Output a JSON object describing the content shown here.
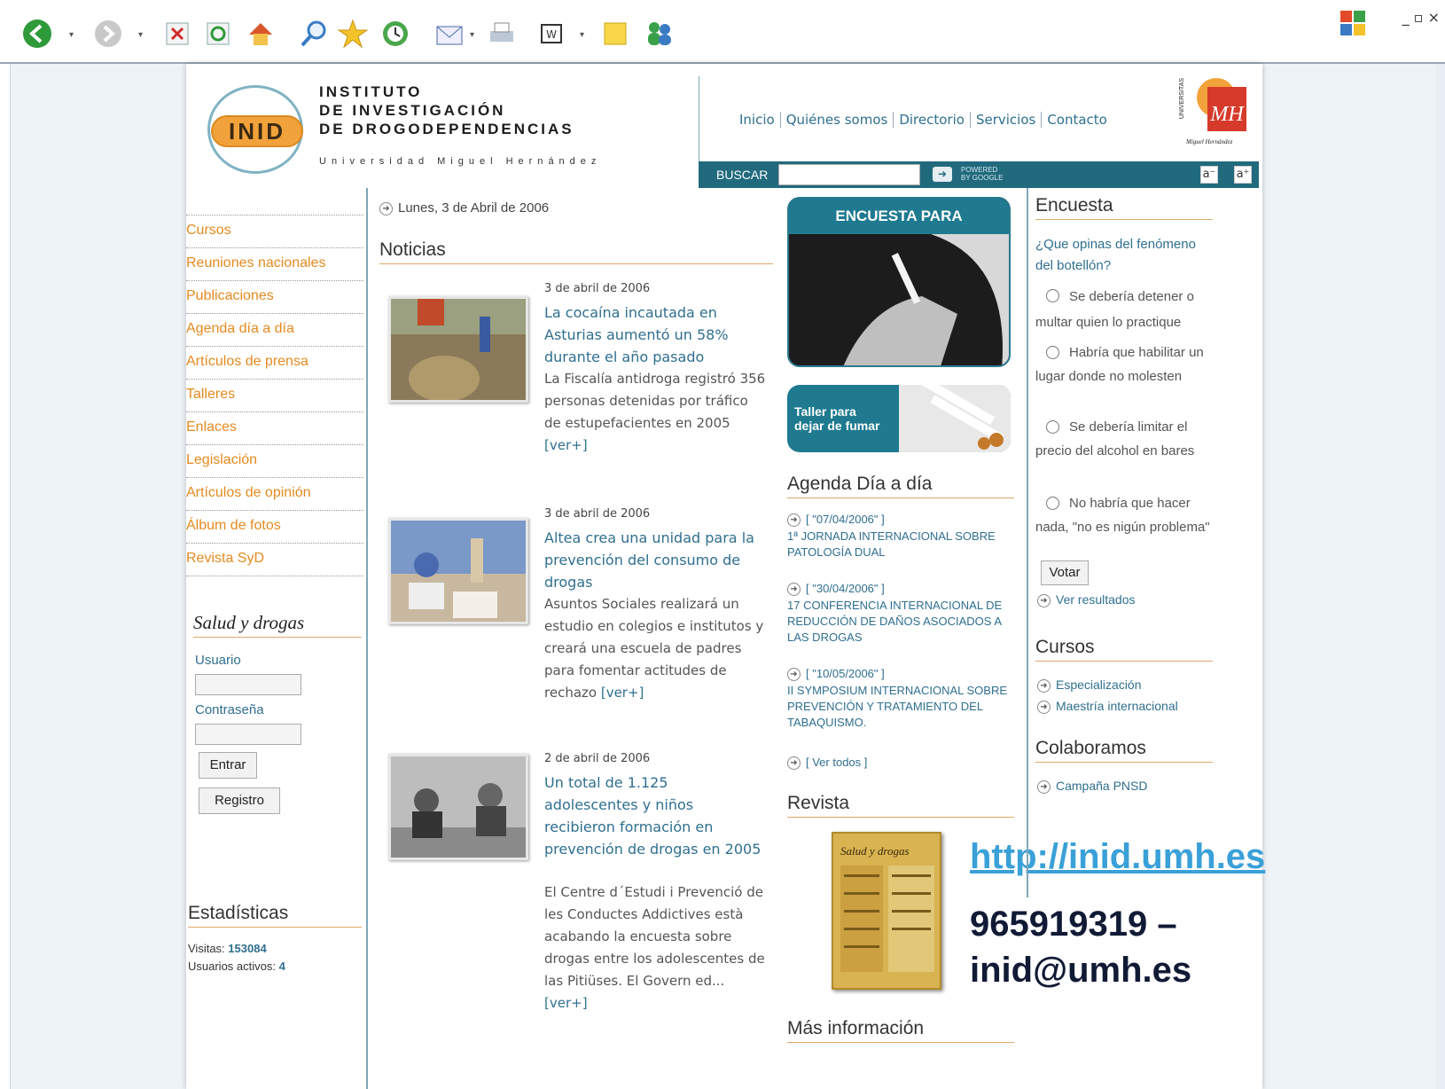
{
  "browser": {
    "toolbar_icons": [
      "back-icon",
      "forward-icon",
      "stop-icon",
      "refresh-icon",
      "home-icon",
      "search-icon",
      "favorites-icon",
      "history-icon",
      "mail-icon",
      "print-icon",
      "edit-icon",
      "notes-icon",
      "messenger-icon"
    ],
    "window_controls": "_ ▫ ×"
  },
  "header": {
    "logo_text": "INID",
    "institute_line1": "INSTITUTO",
    "institute_line2": "DE INVESTIGACIÓN",
    "institute_line3": "DE DROGODEPENDENCIAS",
    "university": "Universidad Miguel Hernández",
    "nav": [
      "Inicio",
      "Quiénes somos",
      "Directorio",
      "Servicios",
      "Contacto"
    ],
    "umh_vertical": "UNIVERSITAS",
    "umh_name": "Miguel Hernández",
    "search_label": "BUSCAR",
    "search_value": "",
    "powered_line1": "POWERED",
    "powered_line2": "BY GOOGLE",
    "font_smaller": "a⁻",
    "font_larger": "a⁺"
  },
  "left": {
    "menu": [
      "Cursos",
      "Reuniones nacionales",
      "Publicaciones",
      "Agenda día a día",
      "Artículos de prensa",
      "Talleres",
      "Enlaces",
      "Legislación",
      "Artículos de opinión",
      "Álbum de fotos",
      "Revista SyD"
    ],
    "salud_title": "Salud y drogas",
    "usuario_label": "Usuario",
    "password_label": "Contraseña",
    "enter_button": "Entrar",
    "register_button": "Registro",
    "stats_title": "Estadísticas",
    "visits_label": "Visitas:",
    "visits_value": "153084",
    "active_label": "Usuarios activos:",
    "active_value": "4"
  },
  "center": {
    "date": "Lunes, 3 de Abril de 2006",
    "news_title": "Noticias",
    "news": [
      {
        "date": "3 de abril de 2006",
        "title": "La cocaína incautada en Asturias aumentó un 58% durante el año pasado",
        "body": "La Fiscalía antidroga registró 356 personas detenidas por tráfico de estupefacientes en 2005",
        "more": "[ver+]"
      },
      {
        "date": "3 de abril de 2006",
        "title": "Altea crea una unidad para la prevención del consumo de drogas",
        "body": "Asuntos Sociales realizará un estudio en colegios e institutos y creará una escuela de padres para fomentar actitudes de rechazo",
        "more": "[ver+]"
      },
      {
        "date": "2 de abril de 2006",
        "title": "Un total de 1.125 adolescentes y niños recibieron formación en prevención de drogas en 2005",
        "body": "El Centre d´Estudi i Prevenció de les Conductes Addictives està acabando la encuesta sobre drogas entre los adolescentes de las Pitiüses. El Govern ed...",
        "more": "[ver+]"
      }
    ]
  },
  "middle": {
    "banner_title": "ENCUESTA PARA FUMADORES",
    "taller_line1": "Taller para",
    "taller_line2": "dejar de fumar",
    "agenda_title": "Agenda Día a día",
    "agenda": [
      {
        "date": "[ \"07/04/2006\" ]",
        "text": "1ª JORNADA INTERNACIONAL SOBRE PATOLOGÍA DUAL"
      },
      {
        "date": "[ \"30/04/2006\" ]",
        "text": "17 CONFERENCIA INTERNACIONAL DE REDUCCIÓN DE DAÑOS ASOCIADOS A LAS DROGAS"
      },
      {
        "date": "[ \"10/05/2006\" ]",
        "text": "II SYMPOSIUM INTERNACIONAL SOBRE PREVENCIÓN Y TRATAMIENTO DEL TABAQUISMO."
      }
    ],
    "see_all": "[ Ver todos ]",
    "revista_title": "Revista",
    "revista_cover_title": "Salud y drogas",
    "more_info_title": "Más información",
    "url": "http://inid.umh.es",
    "phone": "965919319 –",
    "email": "inid@umh.es"
  },
  "right": {
    "poll_title": "Encuesta",
    "question": "¿Que opinas del fenómeno del botellón?",
    "options": [
      "Se debería detener o multar quien lo practique",
      "Habría que habilitar un lugar donde no molesten",
      "Se debería limitar el precio del alcohol en bares",
      "No habría que hacer nada, \"no es nigún problema\""
    ],
    "vote_button": "Votar",
    "results_link": "Ver resultados",
    "courses_title": "Cursos",
    "courses": [
      "Especialización",
      "Maestría internacional"
    ],
    "collab_title": "Colaboramos",
    "collab_link": "Campaña PNSD"
  }
}
